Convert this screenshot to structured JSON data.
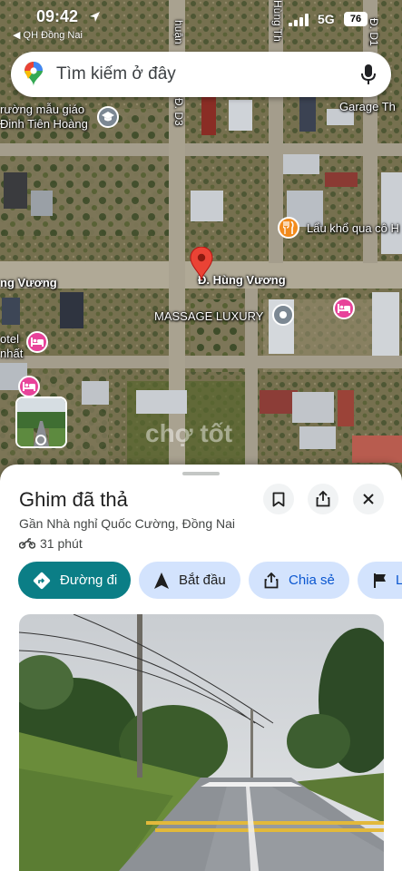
{
  "status_bar": {
    "time": "09:42",
    "carrier_back": "◀ QH Đồng Nai",
    "network": "5G",
    "battery": "76"
  },
  "search": {
    "placeholder": "Tìm kiếm ở đây"
  },
  "map": {
    "labels": {
      "school_line1": "rường mẫu giáo",
      "school_line2": "Đinh Tiên Hoàng",
      "garage": "Garage Th",
      "restaurant": "Lẩu khổ qua cô H",
      "street_left": "ng Vương",
      "street_main": "Đ. Hùng Vương",
      "massage": "MASSAGE LUXURY",
      "hotel_line1": "otel",
      "hotel_line2": "nhất",
      "road_d3": "Đ. D3",
      "road_thuan": "huận",
      "road_hung_tho": "Hùng Th",
      "road_d1": "Đ. D1",
      "watermark": "chợ tốt"
    },
    "colors": {
      "pin": "#ea4335",
      "hotel_poi": "#e8439a",
      "food_poi": "#f28b1d",
      "place_poi": "#7c8893"
    }
  },
  "sheet": {
    "title": "Ghim đã thả",
    "subtitle": "Gần Nhà nghỉ Quốc Cường, Đồng Nai",
    "travel_time": "31 phút",
    "actions": [
      {
        "label": "Đường đi",
        "icon": "directions-icon"
      },
      {
        "label": "Bắt đầu",
        "icon": "navigation-arrow-icon"
      },
      {
        "label": "Chia sẻ",
        "icon": "share-icon"
      },
      {
        "label": "L",
        "icon": "flag-icon"
      }
    ],
    "colors": {
      "primary_chip": "#0b7e86",
      "chip": "#d3e3fd",
      "chip_text": "#0b57d0"
    }
  }
}
